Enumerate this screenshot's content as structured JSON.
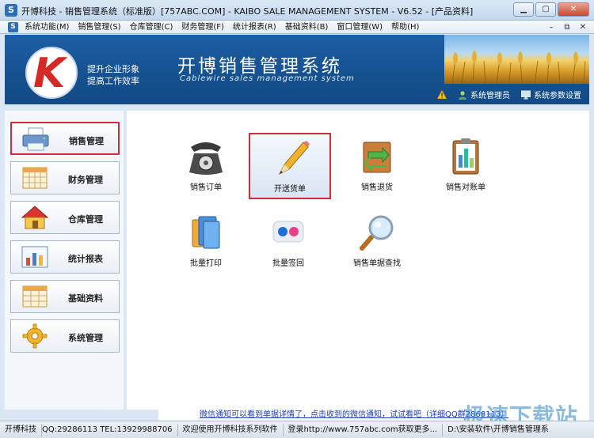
{
  "window": {
    "icon": "S",
    "title": "开博科技 - 销售管理系统（标准版）[757ABC.COM] - KAIBO SALE MANAGEMENT SYSTEM - V6.52 - [产品资料]",
    "minimize": "▁",
    "maximize": "▢",
    "close": "✕"
  },
  "menu": {
    "items": [
      "系统功能(M)",
      "销售管理(S)",
      "仓库管理(C)",
      "财务管理(F)",
      "统计报表(R)",
      "基础资料(B)",
      "窗口管理(W)",
      "帮助(H)"
    ],
    "mdi_minimize": "–",
    "mdi_restore": "⧉",
    "mdi_close": "✕"
  },
  "banner": {
    "logo_text": "K",
    "slogan_line1": "提升企业形象",
    "slogan_line2": "提高工作效率",
    "title": "开博销售管理系统",
    "subtitle": "Cablewire sales management system",
    "links": {
      "admin": "系统管理员",
      "settings": "系统参数设置"
    }
  },
  "sidebar": {
    "items": [
      {
        "label": "销售管理",
        "icon": "printer-icon"
      },
      {
        "label": "财务管理",
        "icon": "calendar-grid-icon"
      },
      {
        "label": "仓库管理",
        "icon": "house-icon"
      },
      {
        "label": "统计报表",
        "icon": "bar-chart-icon"
      },
      {
        "label": "基础资料",
        "icon": "table-icon"
      },
      {
        "label": "系统管理",
        "icon": "gear-icon"
      }
    ],
    "active_index": 0
  },
  "tiles": [
    {
      "label": "销售订单",
      "icon": "telephone-icon"
    },
    {
      "label": "开送货单",
      "icon": "pencil-icon"
    },
    {
      "label": "销售退货",
      "icon": "return-box-icon"
    },
    {
      "label": "销售对账单",
      "icon": "clipboard-chart-icon"
    },
    {
      "label": "批量打印",
      "icon": "folders-icon"
    },
    {
      "label": "批量签回",
      "icon": "flickr-dots-icon"
    },
    {
      "label": "销售单据查找",
      "icon": "magnifier-icon"
    }
  ],
  "ticker": "微信通知可以看到单据详情了，点击收到的微信通知，试试看吧（详细QQ群2868113）",
  "status": {
    "company": "开博科技",
    "contact": "QQ:29286113 TEL:13929988706",
    "welcome": "欢迎使用开博科技系列软件",
    "login": "登录http://www.757abc.com获取更多...",
    "path": "D:\\安装软件\\开博销售管理系"
  },
  "watermark": "极速下载站",
  "colors": {
    "banner_blue": "#1d5ea6",
    "highlight_red": "#d12a3c",
    "link_blue": "#1c3fa8"
  }
}
